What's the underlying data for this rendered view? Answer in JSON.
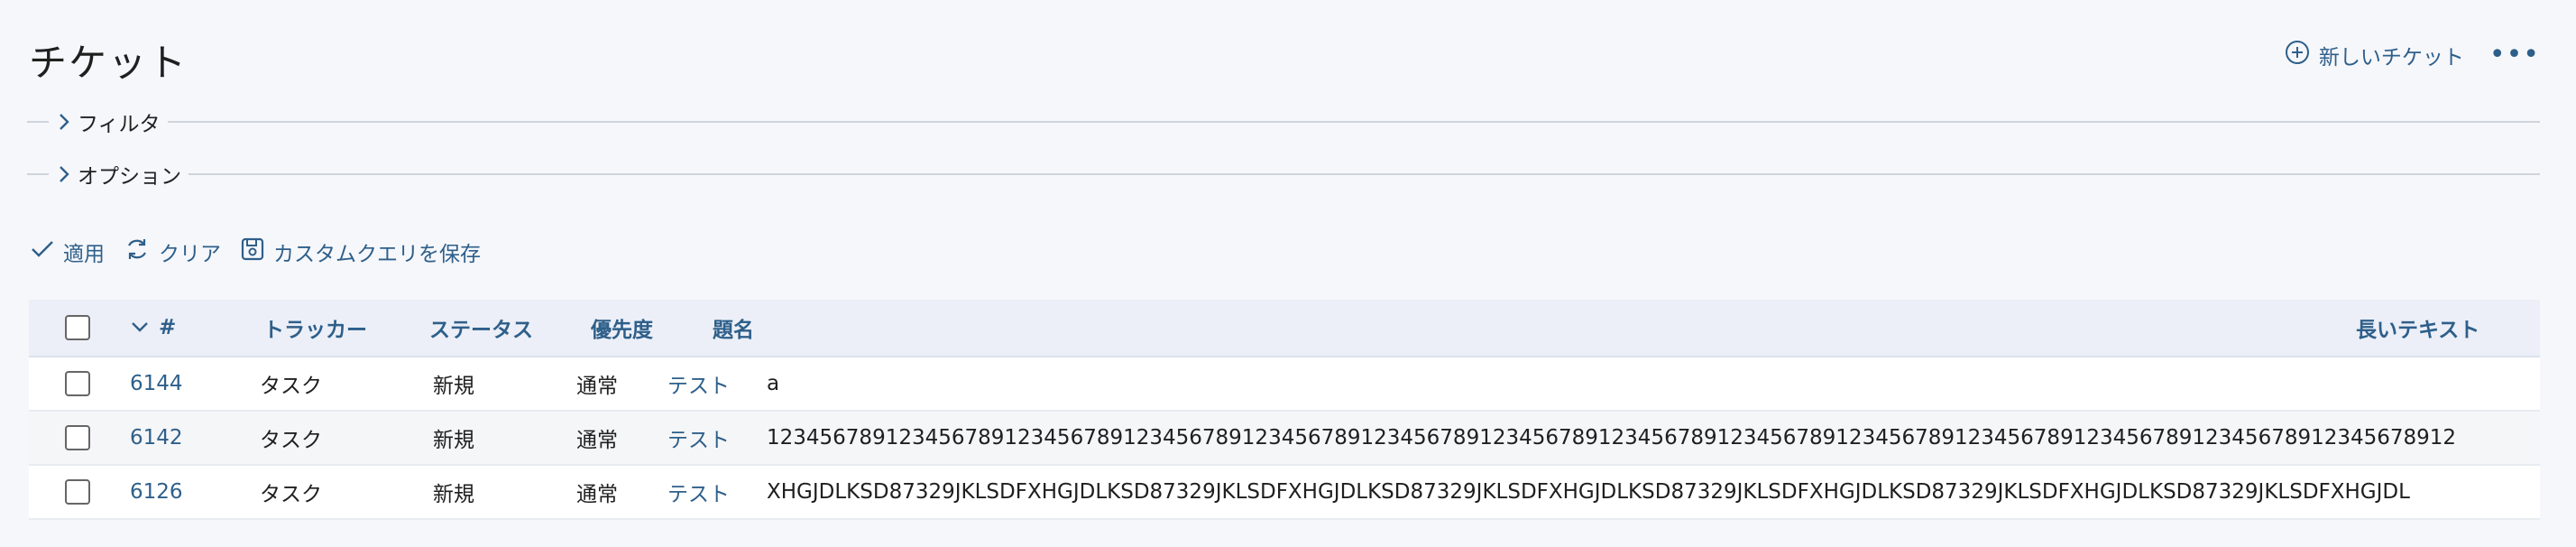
{
  "page": {
    "title": "チケット"
  },
  "top_actions": {
    "new_ticket_label": "新しいチケット",
    "more_icon": "more-horizontal-icon"
  },
  "fieldsets": {
    "filter_label": "フィルタ",
    "options_label": "オプション"
  },
  "actions": {
    "apply_label": "適用",
    "clear_label": "クリア",
    "save_query_label": "カスタムクエリを保存"
  },
  "table": {
    "headers": {
      "id": "#",
      "tracker": "トラッカー",
      "status": "ステータス",
      "priority": "優先度",
      "subject": "題名",
      "long_text": "長いテキスト"
    },
    "rows": [
      {
        "id": "6144",
        "tracker": "タスク",
        "status": "新規",
        "priority": "通常",
        "subject": "テスト",
        "long_text": "a"
      },
      {
        "id": "6142",
        "tracker": "タスク",
        "status": "新規",
        "priority": "通常",
        "subject": "テスト",
        "long_text": "12345678912345678912345678912345678912345678912345678912345678912345678912345678912345678912345678912345678912345678912345678912"
      },
      {
        "id": "6126",
        "tracker": "タスク",
        "status": "新規",
        "priority": "通常",
        "subject": "テスト",
        "long_text": "XHGJDLKSD87329JKLSDFXHGJDLKSD87329JKLSDFXHGJDLKSD87329JKLSDFXHGJDLKSD87329JKLSDFXHGJDLKSD87329JKLSDFXHGJDLKSD87329JKLSDFXHGJDL"
      }
    ]
  },
  "colors": {
    "link": "#2e5f8a",
    "header_bg": "#eceff7",
    "page_bg": "#f6f7fb"
  }
}
